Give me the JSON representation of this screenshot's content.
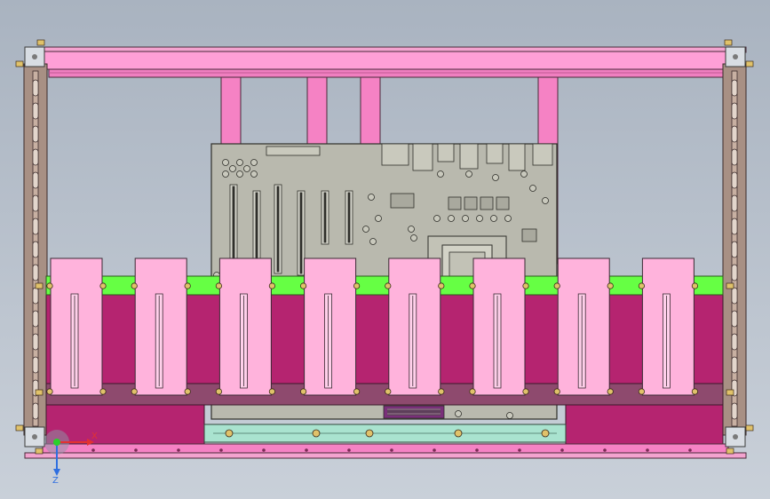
{
  "viewport": {
    "background_top": "#a9b3c0",
    "background_bottom": "#c9d0d9"
  },
  "colors": {
    "frame_pink": "#f07fc0",
    "frame_pink_light": "#ff9fd6",
    "rail_brown": "#a89084",
    "card_pink": "#ffb3dc",
    "card_outline": "#3a2a33",
    "bracket_green": "#66ff44",
    "tray_magenta": "#b52470",
    "board_gray": "#b9b9ae",
    "rail_mint": "#a9e3cf",
    "mount_corner": "#d8dde3",
    "screw_gold": "#e0c26a",
    "axis_x": "#e23232",
    "axis_y": "#2f6fe0",
    "axis_origin": "#2ad02a"
  },
  "gpu_cards": {
    "count": 8,
    "items": [
      {
        "name": "gpu-card-1"
      },
      {
        "name": "gpu-card-2"
      },
      {
        "name": "gpu-card-3"
      },
      {
        "name": "gpu-card-4"
      },
      {
        "name": "gpu-card-5"
      },
      {
        "name": "gpu-card-6"
      },
      {
        "name": "gpu-card-7"
      },
      {
        "name": "gpu-card-8"
      }
    ]
  },
  "triad": {
    "x_label": "X",
    "y_label": "Z",
    "icon": "triad-axis-icon"
  }
}
